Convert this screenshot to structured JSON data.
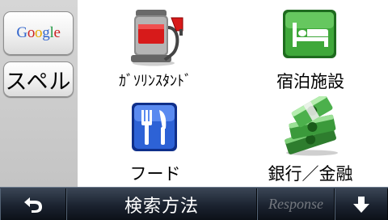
{
  "sidebar": {
    "google_button": {
      "letters": [
        {
          "ch": "G",
          "color": "#3366cc"
        },
        {
          "ch": "o",
          "color": "#cc2222"
        },
        {
          "ch": "o",
          "color": "#e8a800"
        },
        {
          "ch": "g",
          "color": "#3366cc"
        },
        {
          "ch": "l",
          "color": "#229944"
        },
        {
          "ch": "e",
          "color": "#cc2222"
        }
      ]
    },
    "spell_button": {
      "label": "スペル"
    }
  },
  "categories": [
    {
      "label": "ｶﾞｿﾘﾝｽﾀﾝﾄﾞ",
      "icon": "gas-pump-icon"
    },
    {
      "label": "宿泊施設",
      "icon": "bed-icon"
    },
    {
      "label": "フード",
      "icon": "fork-knife-icon"
    },
    {
      "label": "銀行／金融",
      "icon": "money-icon"
    }
  ],
  "bottom_bar": {
    "title": "検索方法",
    "watermark": "Response",
    "back_icon": "back-arrow-icon",
    "down_icon": "down-arrow-icon"
  },
  "colors": {
    "bar_dark": "#1b2330",
    "sidebar_bg": "#cccccc"
  }
}
